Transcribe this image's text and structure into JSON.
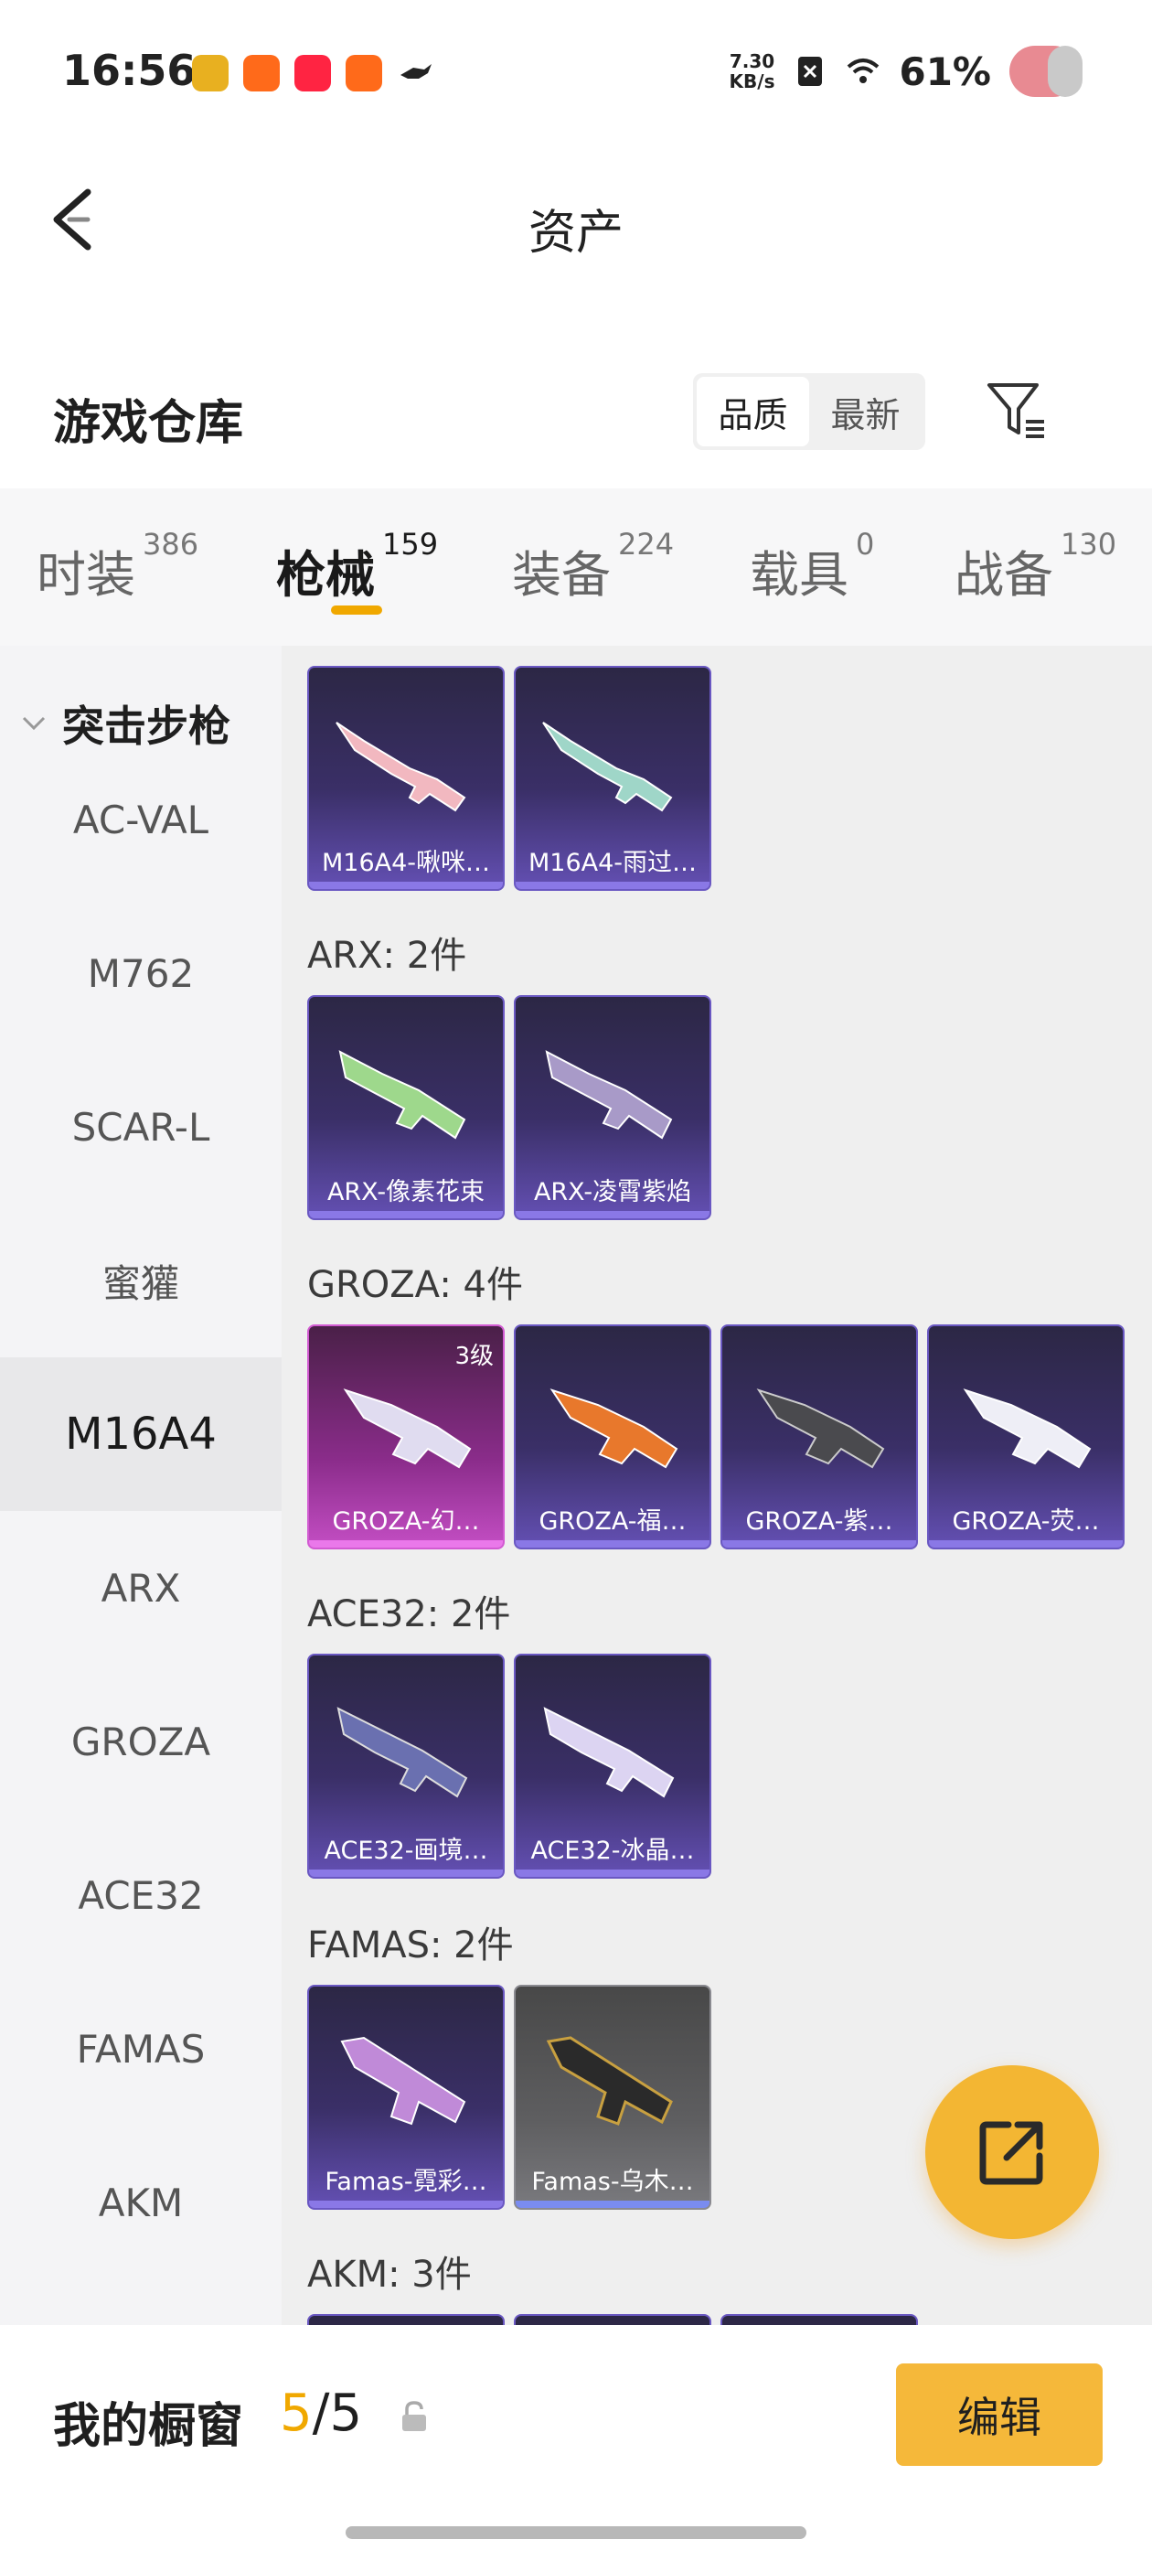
{
  "status": {
    "time": "16:56",
    "net_speed_value": "7.30",
    "net_speed_unit": "KB/s",
    "battery": "61%",
    "notif_icons": [
      "game-app-icon",
      "kuaishou-icon",
      "xiaohongshu-icon",
      "kuaishou-icon",
      "bird-icon"
    ]
  },
  "header": {
    "title": "资产"
  },
  "warehouse": {
    "title": "游戏仓库",
    "sort_options": [
      "品质",
      "最新"
    ],
    "active_sort": "品质"
  },
  "tabs": [
    {
      "label": "时装",
      "count": "386"
    },
    {
      "label": "枪械",
      "count": "159"
    },
    {
      "label": "装备",
      "count": "224"
    },
    {
      "label": "载具",
      "count": "0"
    },
    {
      "label": "战备",
      "count": "130"
    }
  ],
  "active_tab": "枪械",
  "sidebar": {
    "group": "突击步枪",
    "items": [
      "AC-VAL",
      "M762",
      "SCAR-L",
      "蜜獾",
      "M16A4",
      "ARX",
      "GROZA",
      "ACE32",
      "FAMAS",
      "AKM"
    ],
    "active": "M16A4"
  },
  "sections": [
    {
      "label": "",
      "items": [
        {
          "name": "M16A4-啾咪…",
          "style": "purple"
        },
        {
          "name": "M16A4-雨过…",
          "style": "purple"
        }
      ]
    },
    {
      "label": "ARX: 2件",
      "items": [
        {
          "name": "ARX-像素花束",
          "style": "purple"
        },
        {
          "name": "ARX-凌霄紫焰",
          "style": "purple"
        }
      ]
    },
    {
      "label": "GROZA: 4件",
      "items": [
        {
          "name": "GROZA-幻…",
          "style": "pink",
          "level": "3级"
        },
        {
          "name": "GROZA-福…",
          "style": "purple"
        },
        {
          "name": "GROZA-紫…",
          "style": "purple"
        },
        {
          "name": "GROZA-荧…",
          "style": "purple"
        }
      ]
    },
    {
      "label": "ACE32: 2件",
      "items": [
        {
          "name": "ACE32-画境…",
          "style": "purple"
        },
        {
          "name": "ACE32-冰晶…",
          "style": "purple"
        }
      ]
    },
    {
      "label": "FAMAS: 2件",
      "items": [
        {
          "name": "Famas-霓彩…",
          "style": "purple"
        },
        {
          "name": "Famas-乌木…",
          "style": "gray"
        }
      ]
    },
    {
      "label": "AKM: 3件",
      "items": []
    }
  ],
  "bottom": {
    "label": "我的橱窗",
    "current": "5",
    "total": "/5",
    "edit_label": "编辑"
  },
  "colors": {
    "accent": "#f0a800",
    "button": "#f5b83a",
    "card_purple": "#3a2f67",
    "card_pink": "#8a2c8a",
    "card_gray": "#5e5e60"
  }
}
